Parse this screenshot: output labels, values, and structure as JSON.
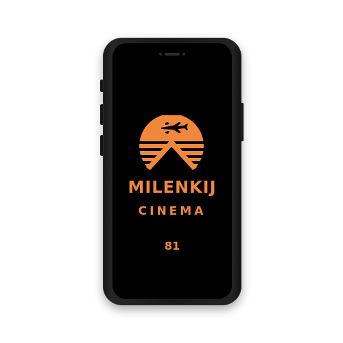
{
  "device": {
    "type": "smartphone",
    "color": "#1a1a1a"
  },
  "splash": {
    "logo_icon": "sunset-airplane-mountain-logo",
    "brand_name": "MILENKIJ",
    "brand_subtitle": "CINEMA",
    "counter": "81",
    "accent_color": "#f0883c",
    "background_color": "#000000"
  }
}
